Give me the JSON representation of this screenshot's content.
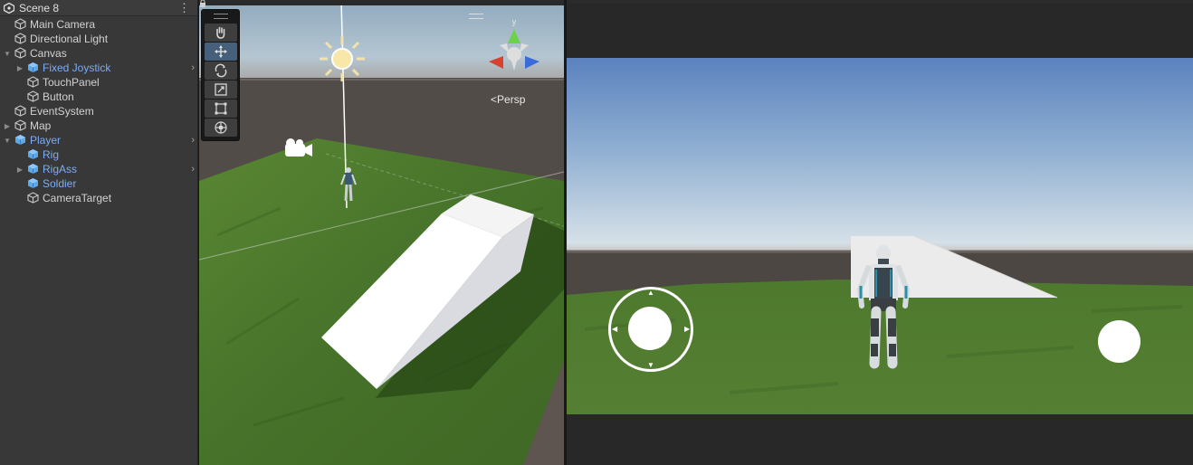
{
  "hierarchy": {
    "scene_title": "Scene 8",
    "menu_icon": "kebab-menu-icon",
    "items": [
      {
        "label": "Main Camera",
        "prefab": false,
        "expanded": null
      },
      {
        "label": "Directional Light",
        "prefab": false,
        "expanded": null
      },
      {
        "label": "Canvas",
        "prefab": false,
        "expanded": true
      },
      {
        "label": "Fixed Joystick",
        "prefab": true,
        "expanded": false
      },
      {
        "label": "TouchPanel",
        "prefab": false,
        "expanded": null
      },
      {
        "label": "Button",
        "prefab": false,
        "expanded": null
      },
      {
        "label": "EventSystem",
        "prefab": false,
        "expanded": null
      },
      {
        "label": "Map",
        "prefab": false,
        "expanded": false
      },
      {
        "label": "Player",
        "prefab": true,
        "expanded": true
      },
      {
        "label": "Rig",
        "prefab": true,
        "expanded": null
      },
      {
        "label": "RigAss",
        "prefab": true,
        "expanded": false
      },
      {
        "label": "Soldier",
        "prefab": true,
        "expanded": null
      },
      {
        "label": "CameraTarget",
        "prefab": false,
        "expanded": null
      }
    ]
  },
  "scene_view": {
    "tools": [
      "hand-tool-icon",
      "move-tool-icon",
      "rotate-tool-icon",
      "scale-tool-icon",
      "rect-tool-icon",
      "transform-tool-icon"
    ],
    "active_tool": "move-tool-icon",
    "projection_label": "Persp",
    "gizmo_axis_label": "y",
    "colors": {
      "sky": "#9bb6c9",
      "ground": "#4f4a47",
      "grass": "#4d7a2c",
      "ramp": "#f2f2f2"
    }
  },
  "game_view": {
    "joystick": "fixed-joystick",
    "action_button": "jump-button",
    "colors": {
      "sky_top": "#5f86c2",
      "horizon": "#c7d6e3",
      "grass": "#4e7a2e",
      "ui": "#ffffff"
    }
  }
}
